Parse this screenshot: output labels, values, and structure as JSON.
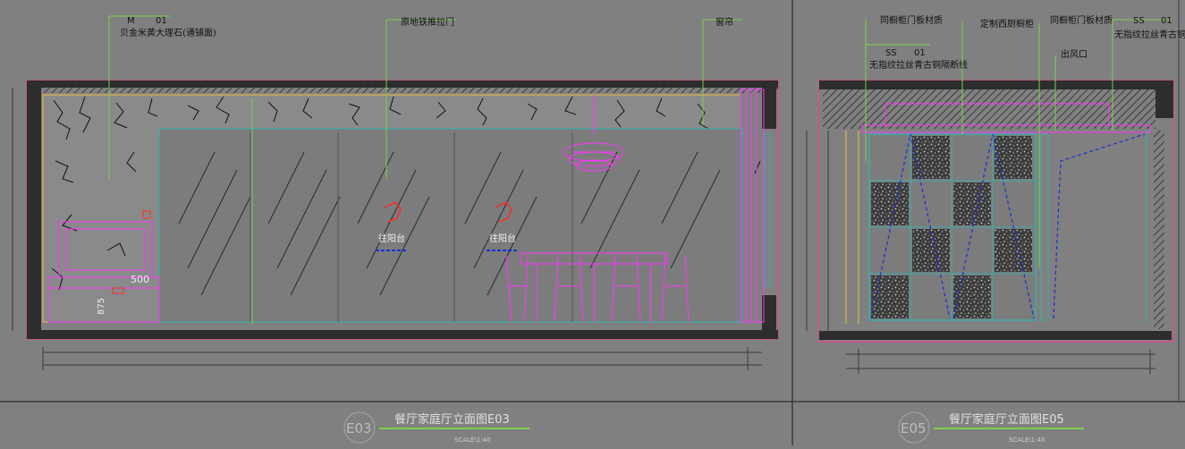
{
  "colors": {
    "background": "#808080",
    "frame_line": "#3a3a3a",
    "wall_black": "#2d2d2d",
    "magenta": "#ff33ff",
    "green": "#7ad04a",
    "yellow": "#e8c040",
    "teal": "#3aaea8",
    "blue": "#1a2fd6",
    "red": "#ff2a2a",
    "label_text": "#111111",
    "title_text": "#e0e0e0"
  },
  "left_elevation": {
    "callouts": {
      "marble_code": "M",
      "marble_no": "01",
      "marble_desc": "贝金米黄大理石(通铺面)",
      "sliding_door": "原地铁推拉门",
      "curtain": "窗帘"
    },
    "arrow_labels": [
      "往阳台",
      "往阳台"
    ],
    "dims": [
      "500",
      "875"
    ],
    "title": {
      "code": "E03",
      "name": "餐厅家庭厅立面图E03",
      "scale": "SCALE\\1:40"
    }
  },
  "right_elevation": {
    "callouts": {
      "left_note": "同橱柜门板材质",
      "mid_note": "定制西厨橱柜",
      "right_note": "同橱柜门板材质",
      "ss_code_right": "SS",
      "ss_no_right": "01",
      "ss_desc_right": "无指纹拉丝青古铜",
      "ss_code_left": "SS",
      "ss_no_left": "01",
      "ss_desc_left": "无指纹拉丝青古铜隔断线",
      "vent": "出风口"
    },
    "title": {
      "code": "E05",
      "name": "餐厅家庭厅立面图E05",
      "scale": "SCALE\\1:40"
    }
  }
}
